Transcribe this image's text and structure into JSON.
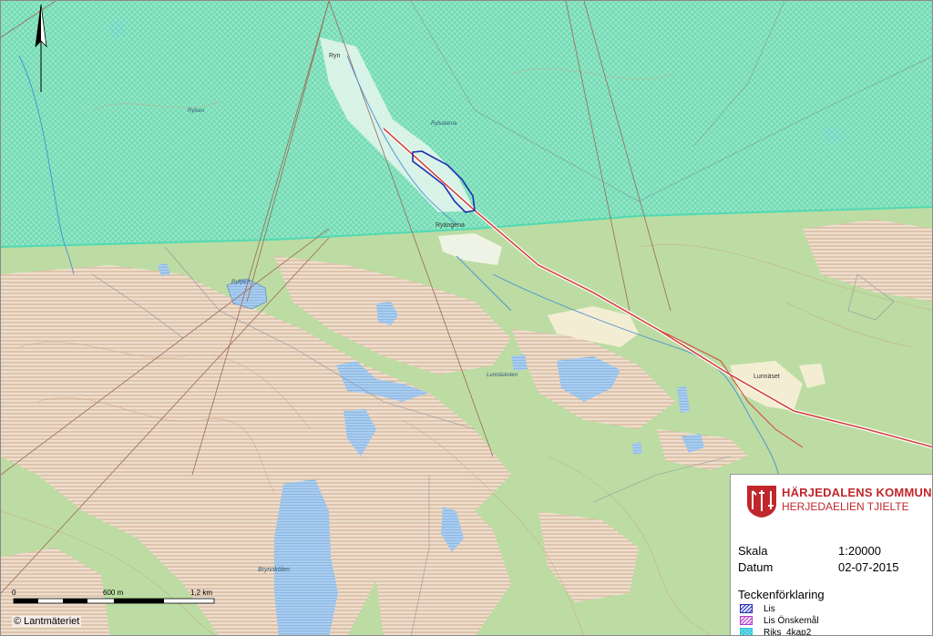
{
  "map": {
    "place_names": [
      {
        "key": "ryn",
        "text": "Ryn"
      },
      {
        "key": "rylsen",
        "text": "Rylsen"
      },
      {
        "key": "rylsalarna",
        "text": "Rylsalarna"
      },
      {
        "key": "ryangena",
        "text": "Ryängena"
      },
      {
        "key": "ryltjarn",
        "text": "Rylfjärn"
      },
      {
        "key": "lunnakolen",
        "text": "Lunnäskolen"
      },
      {
        "key": "lunnaset",
        "text": "Lunnäset"
      },
      {
        "key": "brynnkolen",
        "text": "Brynnkölen"
      }
    ]
  },
  "legend_panel": {
    "org_name": "HÄRJEDALENS KOMMUN",
    "org_subtitle": "HERJEDAELIEN TJIELTE",
    "scale_label": "Skala",
    "scale_value": "1:20000",
    "date_label": "Datum",
    "date_value": "02-07-2015",
    "legend_title": "Teckenförklaring",
    "items": [
      {
        "label": "Lis",
        "color": "#1f2fb0"
      },
      {
        "label": "Lis Önskemål",
        "color": "#b23bc4"
      },
      {
        "label": "Riks_4kap2",
        "color": "#37c4e0"
      }
    ],
    "brand_color": "#c0272d"
  },
  "scale_bar": {
    "start": "0",
    "mid": "600 m",
    "end": "1,2 km"
  },
  "copyright": "© Lantmäteriet",
  "north_arrow": "north-arrow-icon",
  "colors": {
    "forest": "#b9dba0",
    "riks_hatch": "#7ee3c2",
    "water": "#a8cdef",
    "mire": "#ead2b8",
    "road": "#d2443a",
    "lis_outline": "#1f2fb0"
  }
}
